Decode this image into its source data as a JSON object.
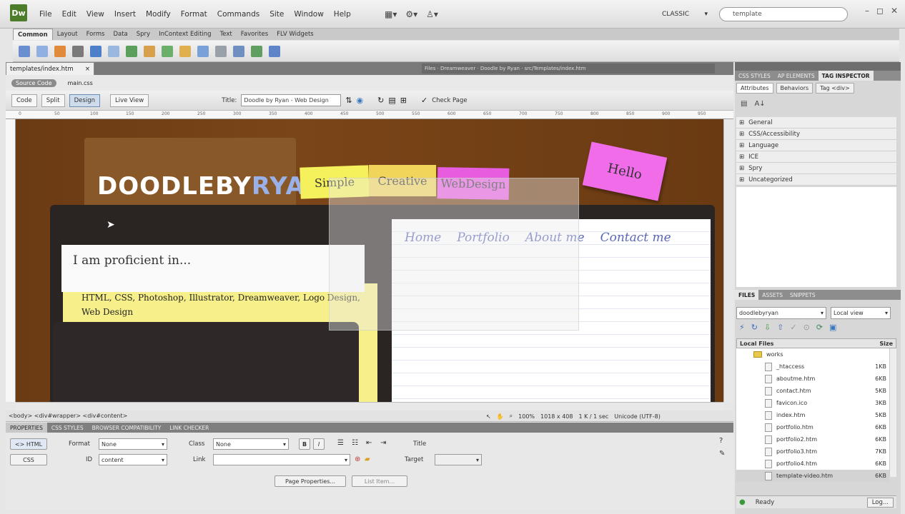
{
  "app": {
    "logo": "Dw",
    "menu": [
      "File",
      "Edit",
      "View",
      "Insert",
      "Modify",
      "Format",
      "Commands",
      "Site",
      "Window",
      "Help"
    ],
    "workspace": "CLASSIC",
    "search_value": "template",
    "window_controls": [
      "–",
      "◻",
      "✕"
    ]
  },
  "insert_bar": {
    "tabs": [
      "Common",
      "Layout",
      "Forms",
      "Data",
      "Spry",
      "InContext Editing",
      "Text",
      "Favorites",
      "FLV Widgets"
    ],
    "active_tab": "Common"
  },
  "document": {
    "tab_label": "templates/index.htm",
    "tab_close": "×",
    "path": "Files · Dreamweaver · Doodle by Ryan · src/Templates/index.htm",
    "related_files": [
      "Source Code",
      "main.css"
    ],
    "views": [
      "Code",
      "Split",
      "Design"
    ],
    "active_view": "Design",
    "live_view": "Live View",
    "title_label": "Title:",
    "title_value": "Doodle by Ryan - Web Design",
    "check_page": "Check Page",
    "ruler_marks": [
      "0",
      "50",
      "100",
      "150",
      "200",
      "250",
      "300",
      "350",
      "400",
      "450",
      "500",
      "550",
      "600",
      "650",
      "700",
      "750",
      "800",
      "850",
      "900",
      "950"
    ]
  },
  "canvas": {
    "logo_main": "DOODLEBY",
    "logo_accent": "RYAN",
    "notes": [
      "Simple",
      "Creative",
      "WebDesign"
    ],
    "hello": "Hello",
    "proficient_heading": "I am proficient in...",
    "skills": "HTML, CSS, Photoshop, Illustrator, Dreamweaver, Logo Design, Web Design",
    "nav": [
      "Home",
      "Portfolio",
      "About me",
      "Contact me"
    ],
    "cursor": "➤"
  },
  "status": {
    "tag_selector": "<body> <div#wrapper> <div#content>",
    "zoom": "100%",
    "dimensions": "1018 x 408",
    "file_size": "1 K / 1 sec",
    "encoding": "Unicode (UTF-8)"
  },
  "properties": {
    "tabs": [
      "PROPERTIES",
      "CSS STYLES",
      "BROWSER COMPATIBILITY",
      "LINK CHECKER"
    ],
    "html_btn": "<> HTML",
    "css_btn": "CSS",
    "format_label": "Format",
    "format_value": "None",
    "id_label": "ID",
    "id_value": "content",
    "class_label": "Class",
    "class_value": "None",
    "link_label": "Link",
    "link_value": "",
    "bold": "B",
    "italic": "I",
    "title_label": "Title",
    "target_label": "Target",
    "page_props": "Page Properties...",
    "list_item": "List Item..."
  },
  "right_panel": {
    "tabs": [
      "CSS STYLES",
      "AP ELEMENTS",
      "TAG INSPECTOR"
    ],
    "active_tab": "TAG INSPECTOR",
    "subtabs": [
      "Attributes",
      "Behaviors",
      "Tag <div>"
    ],
    "categories": [
      "General",
      "CSS/Accessibility",
      "Language",
      "ICE",
      "Spry",
      "Uncategorized"
    ]
  },
  "files_panel": {
    "tabs": [
      "FILES",
      "ASSETS",
      "SNIPPETS"
    ],
    "site": "doodlebyryan",
    "view": "Local view",
    "header_name": "Local Files",
    "header_size": "Size",
    "files": [
      {
        "name": "works",
        "size": "",
        "type": "folder"
      },
      {
        "name": "_htaccess",
        "size": "1KB",
        "type": "file"
      },
      {
        "name": "aboutme.htm",
        "size": "6KB",
        "type": "file"
      },
      {
        "name": "contact.htm",
        "size": "5KB",
        "type": "file"
      },
      {
        "name": "favicon.ico",
        "size": "3KB",
        "type": "file"
      },
      {
        "name": "index.htm",
        "size": "5KB",
        "type": "file"
      },
      {
        "name": "portfolio.htm",
        "size": "6KB",
        "type": "file"
      },
      {
        "name": "portfolio2.htm",
        "size": "6KB",
        "type": "file"
      },
      {
        "name": "portfolio3.htm",
        "size": "7KB",
        "type": "file"
      },
      {
        "name": "portfolio4.htm",
        "size": "6KB",
        "type": "file"
      },
      {
        "name": "template-video.htm",
        "size": "6KB",
        "type": "file"
      }
    ],
    "status": "Ready",
    "log_btn": "Log..."
  },
  "colors": {
    "canvas_brown": "#6b3b14",
    "note_yellow": "#f5f15c",
    "note_pink": "#e85ce0",
    "nav_blue": "#5a67b8"
  }
}
